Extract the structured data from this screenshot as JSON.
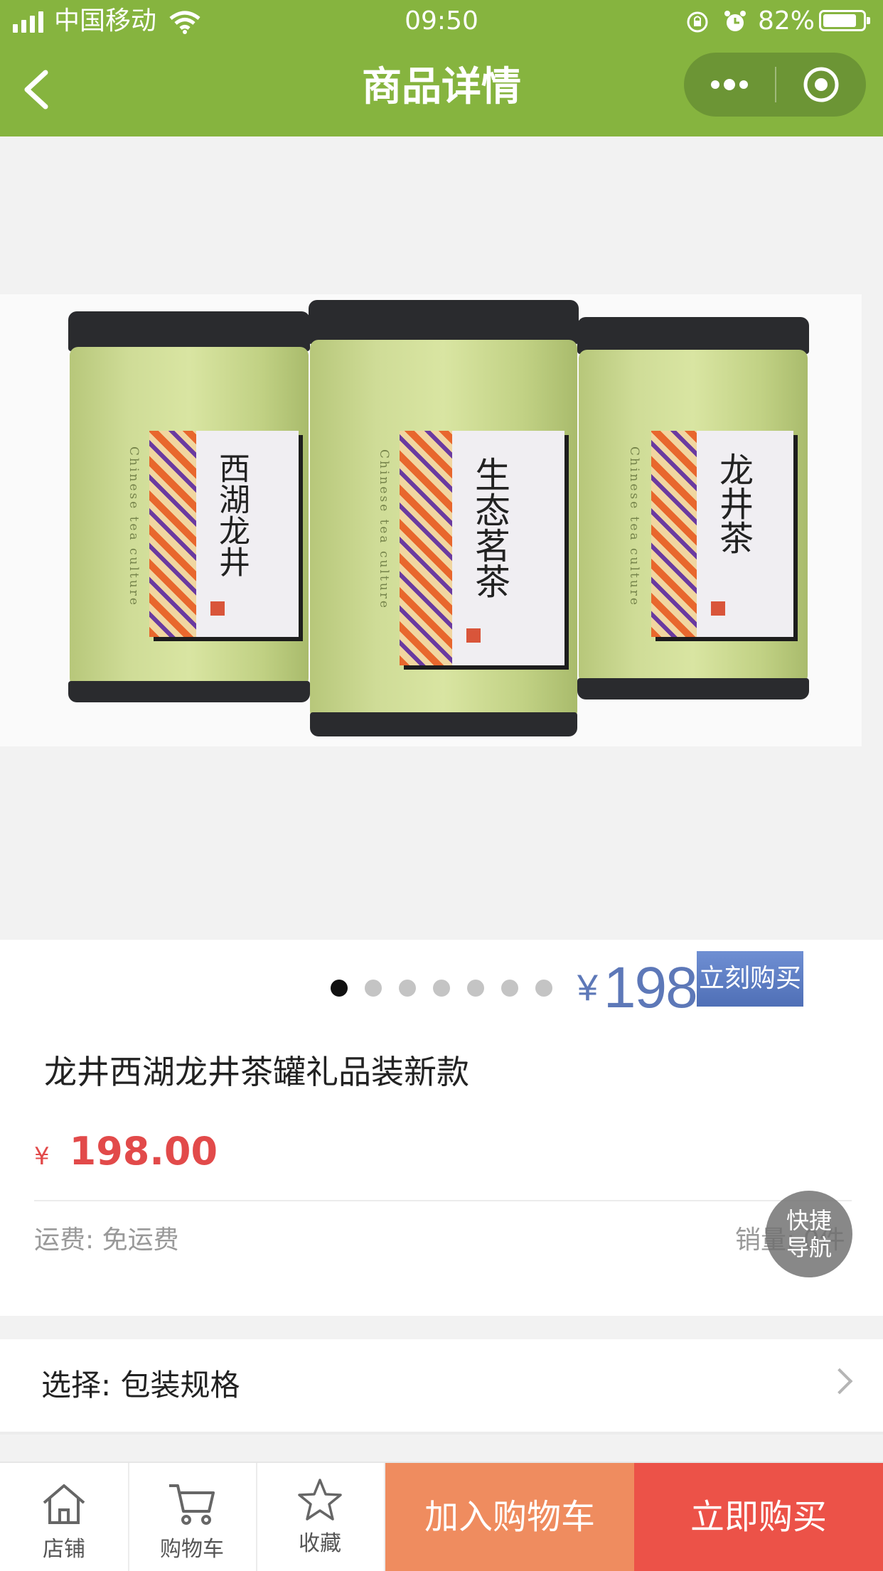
{
  "status_bar": {
    "carrier": "中国移动",
    "time": "09:50",
    "battery": "82%"
  },
  "nav": {
    "title": "商品详情"
  },
  "product_image": {
    "cans": [
      {
        "name": "西湖龙井",
        "subtitle": "Chinese tea culture"
      },
      {
        "name": "生态茗茶",
        "subtitle": "Chinese tea culture"
      },
      {
        "name": "龙井茶",
        "subtitle": "Chinese tea culture"
      }
    ],
    "carousel_count": 7,
    "carousel_active": 1,
    "promo_price": "198",
    "promo_yen": "¥",
    "promo_button": "立刻购买"
  },
  "product": {
    "title": "龙井西湖龙井茶罐礼品装新款",
    "price_symbol": "¥",
    "price": "198.00",
    "shipping": "运费: 免运费",
    "sales": "销量: 0件"
  },
  "quick_nav": {
    "label": "快捷导航"
  },
  "options": {
    "label": "选择: 包装规格"
  },
  "bottom_bar": {
    "store": "店铺",
    "cart": "购物车",
    "favorite": "收藏",
    "add_to_cart": "加入购物车",
    "buy_now": "立即购买"
  },
  "colors": {
    "theme_green": "#86b43f",
    "price_red": "#e24a4a",
    "cart_orange": "#ef8c5f",
    "buy_red": "#ec5248"
  }
}
